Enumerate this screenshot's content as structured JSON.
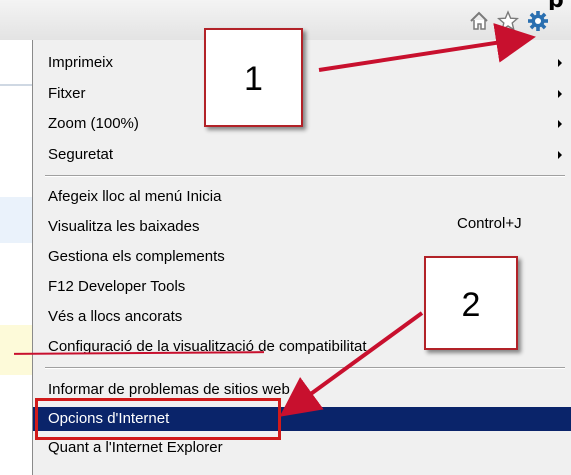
{
  "toolbar": {
    "icons": [
      "home-icon",
      "star-icon",
      "gear-icon"
    ]
  },
  "menu": {
    "items": [
      {
        "label": "Imprimeix",
        "submenu": true
      },
      {
        "label": "Fitxer",
        "submenu": true
      },
      {
        "label": "Zoom (100%)",
        "submenu": true
      },
      {
        "label": "Seguretat",
        "submenu": true
      },
      {
        "label": "Afegeix lloc al menú Inicia"
      },
      {
        "label": "Visualitza les baixades",
        "shortcut": "Control+J"
      },
      {
        "label": "Gestiona els complements"
      },
      {
        "label": "F12 Developer Tools"
      },
      {
        "label": "Vés a llocs ancorats"
      },
      {
        "label": "Configuració de la visualització de compatibilitat"
      },
      {
        "label": "Informar de problemas de sitios web"
      },
      {
        "label": "Opcions d'Internet",
        "highlighted": true
      },
      {
        "label": "Quant a l'Internet Explorer"
      }
    ]
  },
  "annotations": {
    "callout_1": "1",
    "callout_2": "2",
    "accent_color": "#c8102e",
    "highlight_color": "#0a246a"
  }
}
